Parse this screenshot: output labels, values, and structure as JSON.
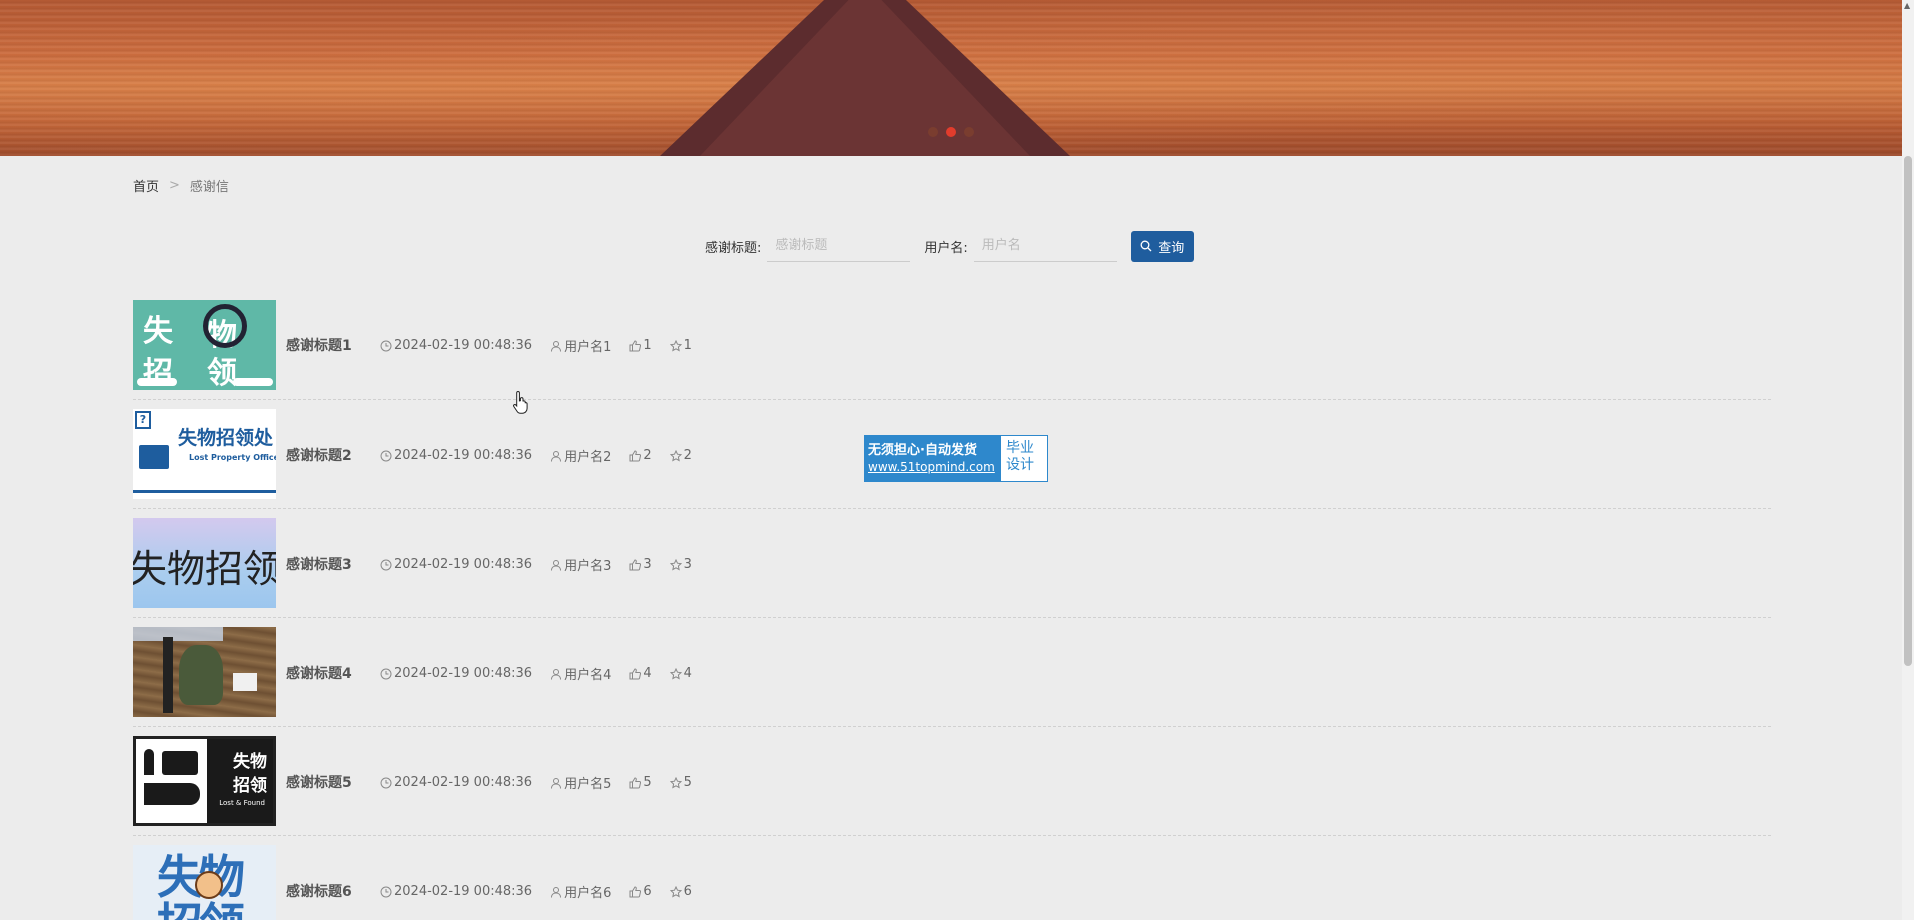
{
  "banner": {
    "slides": [
      {
        "active": false
      },
      {
        "active": true
      },
      {
        "active": false
      }
    ],
    "colors": {
      "sunset": "#c8683c",
      "road": "#5c2c2e",
      "active_dot": "#e23c2c"
    }
  },
  "breadcrumb": {
    "home": "首页",
    "separator": ">",
    "current": "感谢信"
  },
  "search": {
    "title_label": "感谢标题:",
    "title_placeholder": "感谢标题",
    "username_label": "用户名:",
    "username_placeholder": "用户名",
    "button_label": "查询",
    "button_color": "#1f5d9e"
  },
  "items": [
    {
      "title": "感谢标题1",
      "time": "2024-02-19 00:48:36",
      "user": "用户名1",
      "likes": "1",
      "favorites": "1",
      "thumb_text": [
        "失",
        "物",
        "招",
        "领"
      ]
    },
    {
      "title": "感谢标题2",
      "time": "2024-02-19 00:48:36",
      "user": "用户名2",
      "likes": "2",
      "favorites": "2",
      "thumb_text": [
        "失物招领处",
        "Lost Property Office",
        "?"
      ]
    },
    {
      "title": "感谢标题3",
      "time": "2024-02-19 00:48:36",
      "user": "用户名3",
      "likes": "3",
      "favorites": "3",
      "thumb_text": [
        "失物招领"
      ]
    },
    {
      "title": "感谢标题4",
      "time": "2024-02-19 00:48:36",
      "user": "用户名4",
      "likes": "4",
      "favorites": "4",
      "thumb_text": []
    },
    {
      "title": "感谢标题5",
      "time": "2024-02-19 00:48:36",
      "user": "用户名5",
      "likes": "5",
      "favorites": "5",
      "thumb_text": [
        "失物",
        "招领",
        "Lost & Found"
      ]
    },
    {
      "title": "感谢标题6",
      "time": "2024-02-19 00:48:36",
      "user": "用户名6",
      "likes": "6",
      "favorites": "6",
      "thumb_text": [
        "失物",
        "招领"
      ]
    }
  ],
  "ad": {
    "line1": "无须担心·自动发货",
    "line2": "www.51topmind.com",
    "side1": "毕业",
    "side2": "设计"
  }
}
